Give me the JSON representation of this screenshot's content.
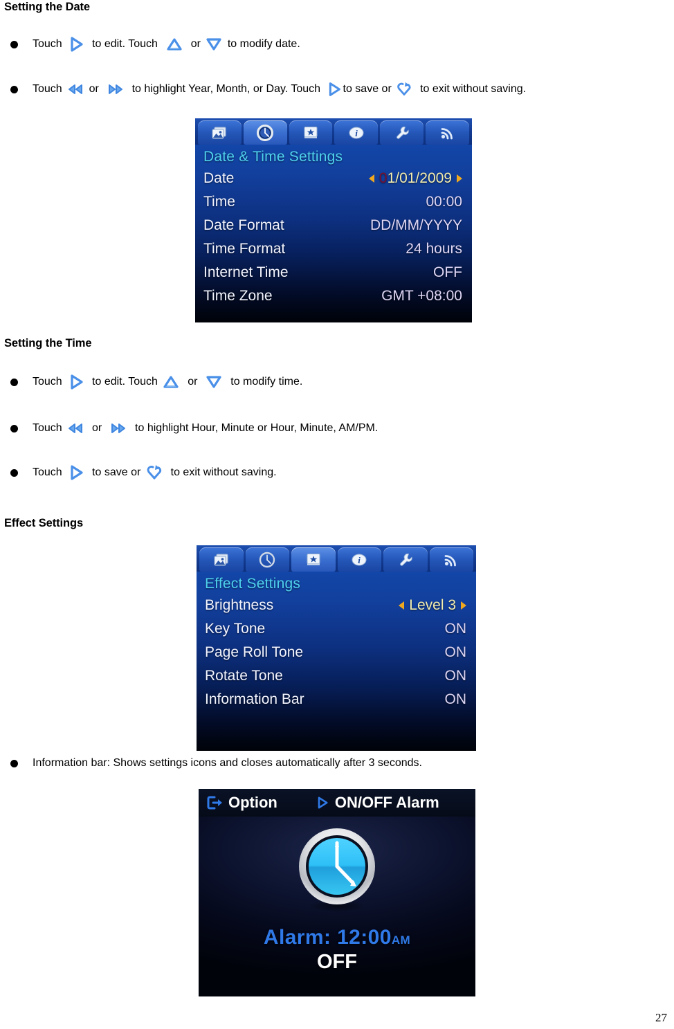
{
  "document": {
    "page_number": "27"
  },
  "sections": {
    "setting_date": {
      "heading": "Setting the Date",
      "bullets": [
        {
          "parts": [
            {
              "type": "text",
              "value": "Touch "
            },
            {
              "type": "icon",
              "value": "play-right-icon"
            },
            {
              "type": "text",
              "value": "  to edit. Touch  "
            },
            {
              "type": "icon",
              "value": "triangle-up-icon"
            },
            {
              "type": "text",
              "value": "  or "
            },
            {
              "type": "icon",
              "value": "triangle-down-icon"
            },
            {
              "type": "text",
              "value": " to modify date."
            }
          ]
        },
        {
          "parts": [
            {
              "type": "text",
              "value": "Touch "
            },
            {
              "type": "icon",
              "value": "rewind-double-left-icon"
            },
            {
              "type": "text",
              "value": " or  "
            },
            {
              "type": "icon",
              "value": "forward-double-right-icon"
            },
            {
              "type": "text",
              "value": "  to highlight Year, Month, or Day. Touch "
            },
            {
              "type": "icon",
              "value": "play-right-icon"
            },
            {
              "type": "text",
              "value": "to save or "
            },
            {
              "type": "icon",
              "value": "exit-return-icon"
            },
            {
              "type": "text",
              "value": "  to exit without saving."
            }
          ]
        }
      ]
    },
    "setting_time": {
      "heading": "Setting the Time",
      "bullets": [
        {
          "parts": [
            {
              "type": "text",
              "value": "Touch "
            },
            {
              "type": "icon",
              "value": "play-right-icon"
            },
            {
              "type": "text",
              "value": "  to edit. Touch "
            },
            {
              "type": "icon",
              "value": "triangle-up-icon"
            },
            {
              "type": "text",
              "value": "  or  "
            },
            {
              "type": "icon",
              "value": "triangle-down-icon"
            },
            {
              "type": "text",
              "value": "  to modify time."
            }
          ]
        },
        {
          "parts": [
            {
              "type": "text",
              "value": "Touch "
            },
            {
              "type": "icon",
              "value": "rewind-double-left-icon"
            },
            {
              "type": "text",
              "value": "  or  "
            },
            {
              "type": "icon",
              "value": "forward-double-right-icon"
            },
            {
              "type": "text",
              "value": "  to highlight Hour, Minute or Hour, Minute, AM/PM."
            }
          ]
        },
        {
          "parts": [
            {
              "type": "text",
              "value": "Touch "
            },
            {
              "type": "icon",
              "value": "play-right-icon"
            },
            {
              "type": "text",
              "value": "  to save or "
            },
            {
              "type": "icon",
              "value": "exit-return-icon"
            },
            {
              "type": "text",
              "value": "  to exit without saving."
            }
          ]
        }
      ]
    },
    "effect_settings": {
      "heading": "Effect Settings",
      "bullets": [
        {
          "parts": [
            {
              "type": "text",
              "value": "Information bar: Shows settings icons and closes automatically after 3 seconds."
            }
          ]
        }
      ]
    }
  },
  "device_screens": {
    "date_time": {
      "title": "Date & Time Settings",
      "tabs": [
        {
          "icon": "photo-icon",
          "active": false
        },
        {
          "icon": "clock-icon",
          "active": true
        },
        {
          "icon": "star-frame-icon",
          "active": false
        },
        {
          "icon": "info-icon",
          "active": false
        },
        {
          "icon": "wrench-icon",
          "active": false
        },
        {
          "icon": "rss-icon",
          "active": false
        }
      ],
      "rows": [
        {
          "label": "Date",
          "value": "01/01/2009",
          "selector": true,
          "highlight_first": "0",
          "rest": "1/01/2009"
        },
        {
          "label": "Time",
          "value": "00:00",
          "selector": false
        },
        {
          "label": "Date Format",
          "value": "DD/MM/YYYY",
          "selector": false
        },
        {
          "label": "Time Format",
          "value": "24 hours",
          "selector": false
        },
        {
          "label": "Internet Time",
          "value": "OFF",
          "selector": false
        },
        {
          "label": "Time Zone",
          "value": "GMT +08:00",
          "selector": false
        }
      ]
    },
    "effect": {
      "title": "Effect Settings",
      "tabs": [
        {
          "icon": "photo-icon",
          "active": false
        },
        {
          "icon": "clock-icon",
          "active": false
        },
        {
          "icon": "star-frame-icon",
          "active": true
        },
        {
          "icon": "info-icon",
          "active": false
        },
        {
          "icon": "wrench-icon",
          "active": false
        },
        {
          "icon": "rss-icon",
          "active": false
        }
      ],
      "rows": [
        {
          "label": "Brightness",
          "value": "Level 3",
          "selector": true
        },
        {
          "label": "Key Tone",
          "value": "ON",
          "selector": false
        },
        {
          "label": "Page Roll Tone",
          "value": "ON",
          "selector": false
        },
        {
          "label": "Rotate Tone",
          "value": "ON",
          "selector": false
        },
        {
          "label": "Information Bar",
          "value": "ON",
          "selector": false
        }
      ]
    },
    "alarm": {
      "topbar": {
        "option_label": "Option",
        "option_icon": "exit-door-icon",
        "alarm_toggle_label": "ON/OFF Alarm",
        "alarm_toggle_icon": "play-right-icon"
      },
      "clock_icon": "analog-clock-icon",
      "alarm_label": "Alarm: 12:00",
      "alarm_ampm": "AM",
      "alarm_state": "OFF"
    }
  },
  "colors": {
    "icon_blue": "#4a90e8",
    "screen_title_cyan": "#4fd2ee",
    "selector_amber": "#f0a91e",
    "value_lavender": "#ded6f5",
    "highlight_maroon": "#7a1030",
    "alarm_blue": "#2f79e8"
  }
}
